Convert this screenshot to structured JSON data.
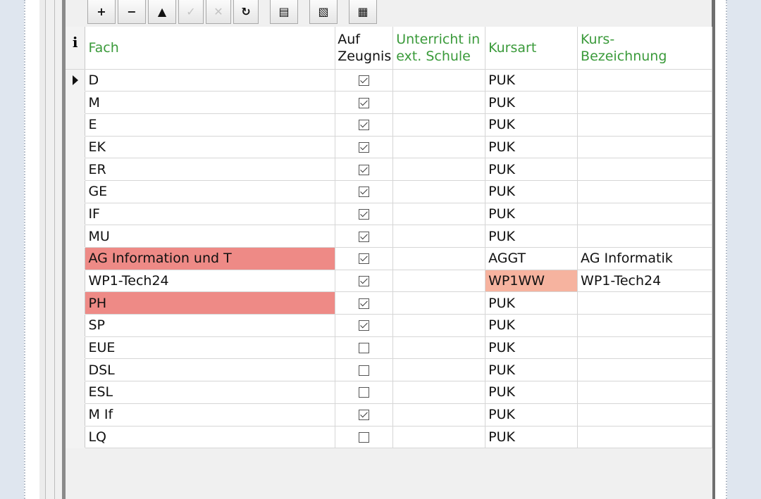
{
  "toolbar": {
    "buttons": [
      {
        "name": "add-button",
        "icon": "plus-icon",
        "glyph": "+"
      },
      {
        "name": "remove-button",
        "icon": "minus-icon",
        "glyph": "−"
      },
      {
        "name": "move-up-button",
        "icon": "triangle-up-icon",
        "glyph": "▲"
      },
      {
        "name": "confirm-button",
        "icon": "check-icon",
        "glyph": "✓"
      },
      {
        "name": "cancel-button",
        "icon": "close-icon",
        "glyph": "✕"
      },
      {
        "name": "refresh-button",
        "icon": "refresh-icon",
        "glyph": "↻"
      },
      {
        "name": "export-button",
        "icon": "export-icon",
        "glyph": "▤"
      },
      {
        "name": "copy-button",
        "icon": "copy-icon",
        "glyph": "▧"
      },
      {
        "name": "edit-table-button",
        "icon": "edit-table-icon",
        "glyph": "▦"
      }
    ]
  },
  "grid": {
    "info_label": "i",
    "columns": {
      "fach": "Fach",
      "auf_zeugnis": "Auf\nZeugnis",
      "unterricht": "Unterricht in\next. Schule",
      "kursart": "Kursart",
      "kurs_bezeichnung": "Kurs-\nBezeichnung"
    },
    "rows": [
      {
        "fach": "D",
        "auf_zeugnis": true,
        "unterricht": "",
        "kursart": "PUK",
        "kurs_bezeichnung": "",
        "current": true
      },
      {
        "fach": "M",
        "auf_zeugnis": true,
        "unterricht": "",
        "kursart": "PUK",
        "kurs_bezeichnung": ""
      },
      {
        "fach": "E",
        "auf_zeugnis": true,
        "unterricht": "",
        "kursart": "PUK",
        "kurs_bezeichnung": ""
      },
      {
        "fach": "EK",
        "auf_zeugnis": true,
        "unterricht": "",
        "kursart": "PUK",
        "kurs_bezeichnung": ""
      },
      {
        "fach": "ER",
        "auf_zeugnis": true,
        "unterricht": "",
        "kursart": "PUK",
        "kurs_bezeichnung": ""
      },
      {
        "fach": "GE",
        "auf_zeugnis": true,
        "unterricht": "",
        "kursart": "PUK",
        "kurs_bezeichnung": ""
      },
      {
        "fach": "IF",
        "auf_zeugnis": true,
        "unterricht": "",
        "kursart": "PUK",
        "kurs_bezeichnung": ""
      },
      {
        "fach": "MU",
        "auf_zeugnis": true,
        "unterricht": "",
        "kursart": "PUK",
        "kurs_bezeichnung": ""
      },
      {
        "fach": "AG Information und T",
        "auf_zeugnis": true,
        "unterricht": "",
        "kursart": "AGGT",
        "kurs_bezeichnung": "AG Informatik",
        "fach_highlight": "#ee8a86"
      },
      {
        "fach": "WP1-Tech24",
        "auf_zeugnis": true,
        "unterricht": "",
        "kursart": "WP1WW",
        "kurs_bezeichnung": "WP1-Tech24",
        "kursart_highlight": "#f6b39f"
      },
      {
        "fach": "PH",
        "auf_zeugnis": true,
        "unterricht": "",
        "kursart": "PUK",
        "kurs_bezeichnung": "",
        "fach_highlight": "#ee8a86"
      },
      {
        "fach": "SP",
        "auf_zeugnis": true,
        "unterricht": "",
        "kursart": "PUK",
        "kurs_bezeichnung": ""
      },
      {
        "fach": "EUE",
        "auf_zeugnis": false,
        "unterricht": "",
        "kursart": "PUK",
        "kurs_bezeichnung": ""
      },
      {
        "fach": "DSL",
        "auf_zeugnis": false,
        "unterricht": "",
        "kursart": "PUK",
        "kurs_bezeichnung": ""
      },
      {
        "fach": "ESL",
        "auf_zeugnis": false,
        "unterricht": "",
        "kursart": "PUK",
        "kurs_bezeichnung": ""
      },
      {
        "fach": "M If",
        "auf_zeugnis": true,
        "unterricht": "",
        "kursart": "PUK",
        "kurs_bezeichnung": ""
      },
      {
        "fach": "LQ",
        "auf_zeugnis": false,
        "unterricht": "",
        "kursart": "PUK",
        "kurs_bezeichnung": ""
      }
    ]
  },
  "colors": {
    "header_green": "#3a9a3a",
    "highlight_red": "#ee8a86",
    "highlight_orange": "#f6b39f"
  }
}
